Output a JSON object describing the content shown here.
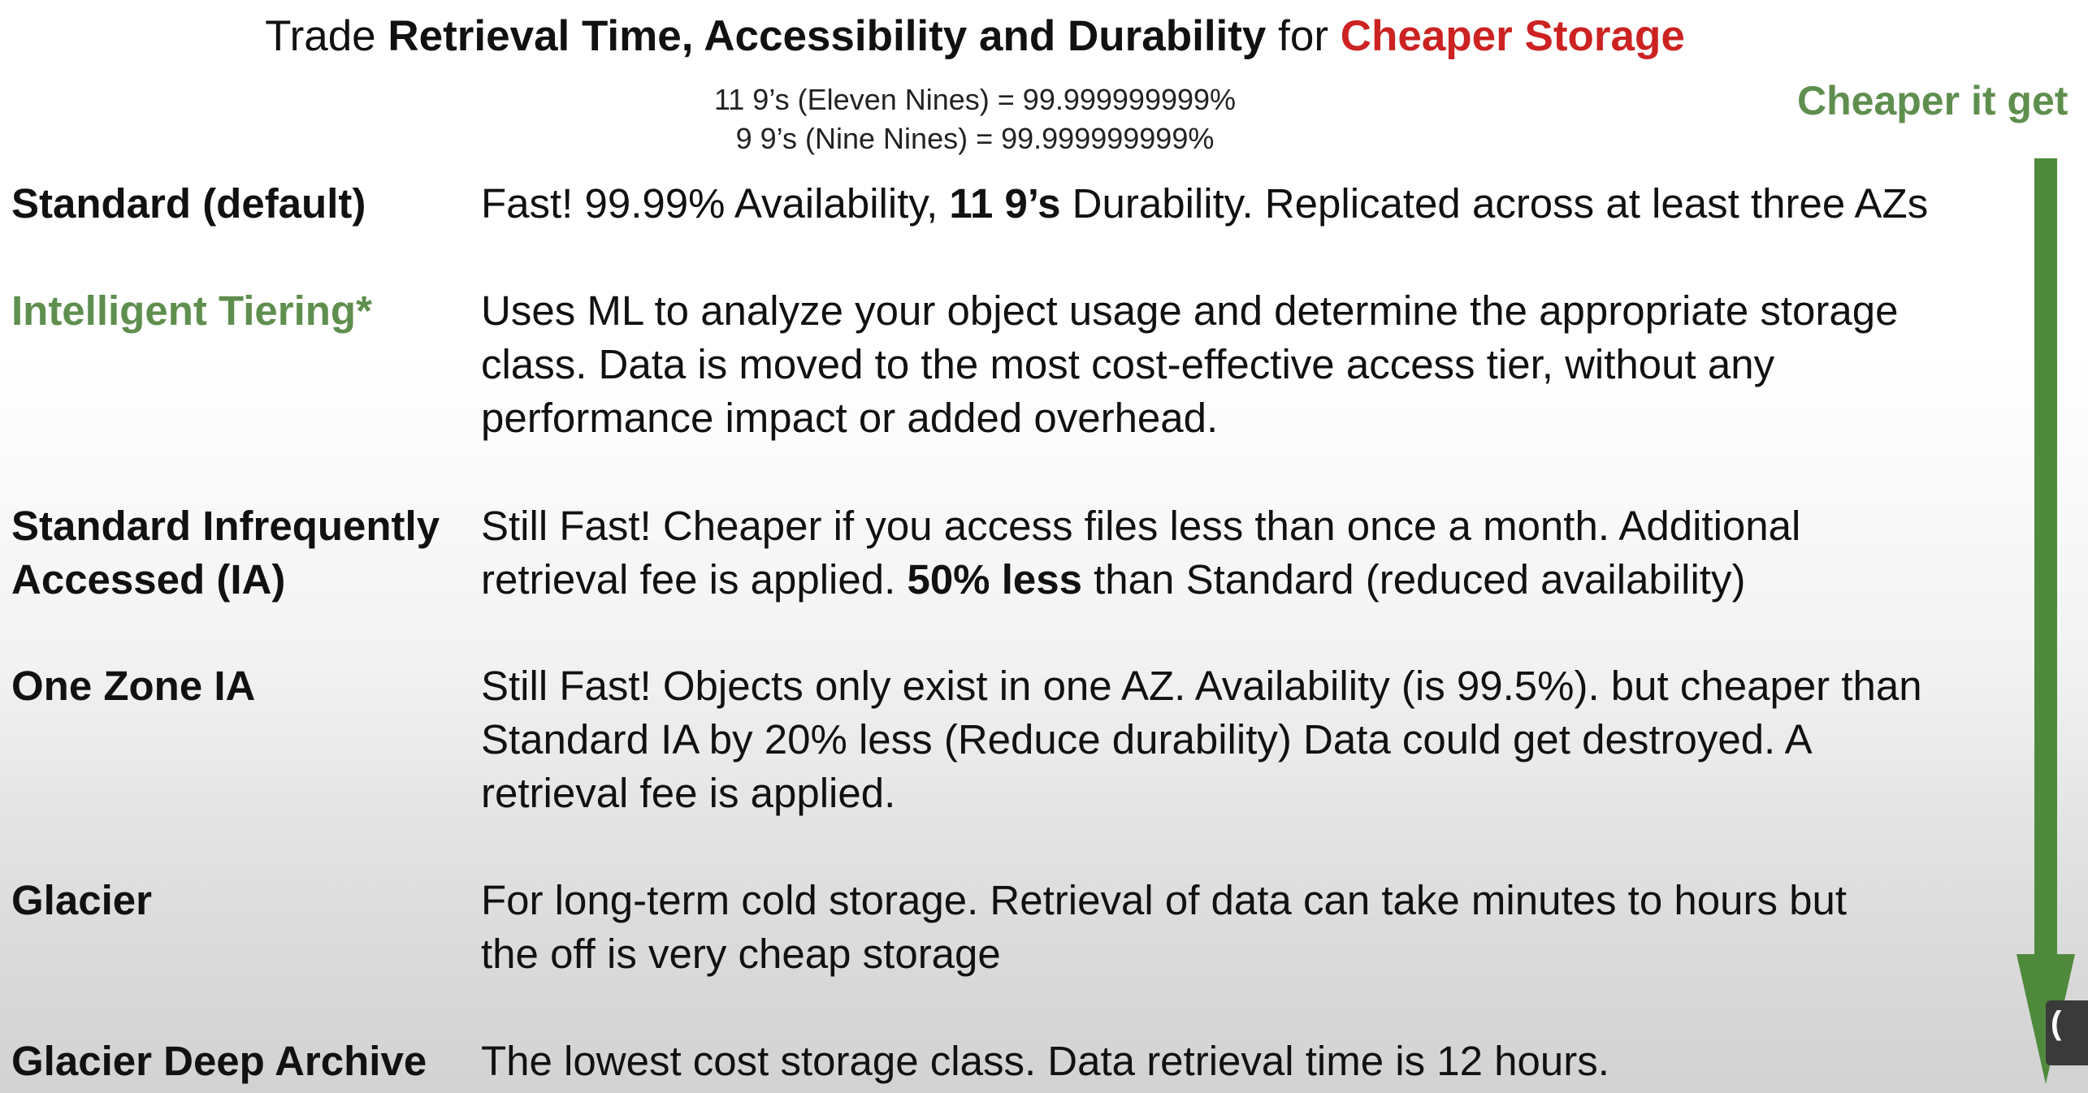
{
  "title": {
    "prefix": "Trade ",
    "bold": "Retrieval Time, Accessibility and Durability",
    "mid": " for ",
    "highlight": "Cheaper Storage"
  },
  "nines": {
    "line1": "11 9’s (Eleven Nines) = 99.999999999%",
    "line2": "9 9’s (Nine Nines) = 99.999999999%"
  },
  "arrow_label": "Cheaper it get",
  "colors": {
    "accent_green": "#5f8f4e",
    "highlight_red": "#cc2222",
    "arrow_green": "#4f8a3c"
  },
  "classes": [
    {
      "name": "Standard (default)",
      "desc": {
        "a": "Fast! 99.99% Availability, ",
        "b": "11 9’s",
        "c": " Durability. Replicated across at least three AZs"
      }
    },
    {
      "name": "Intelligent Tiering*",
      "lines": [
        "Uses ML to analyze your object usage and determine the appropriate storage",
        "class. Data is moved to the most cost-effective access tier, without any",
        "performance impact or added overhead."
      ]
    },
    {
      "name1": "Standard Infrequently",
      "name2": "Accessed (IA)",
      "line1": "Still Fast!  Cheaper if you access files less than once a month. Additional",
      "line2": {
        "a": "retrieval fee is applied. ",
        "b": "50% less",
        "c": " than Standard (reduced availability)"
      }
    },
    {
      "name": "One Zone IA",
      "lines": [
        "Still Fast! Objects only exist in one AZ. Availability (is 99.5%). but cheaper than",
        "Standard IA by 20% less  (Reduce durability) Data could get destroyed. A",
        "retrieval fee is applied."
      ]
    },
    {
      "name": "Glacier",
      "lines": [
        "For long-term cold storage. Retrieval of data can take minutes to hours but",
        "the off is very cheap storage"
      ]
    },
    {
      "name": "Glacier Deep Archive",
      "lines": [
        "The lowest cost storage class. Data retrieval time is 12 hours."
      ]
    }
  ]
}
